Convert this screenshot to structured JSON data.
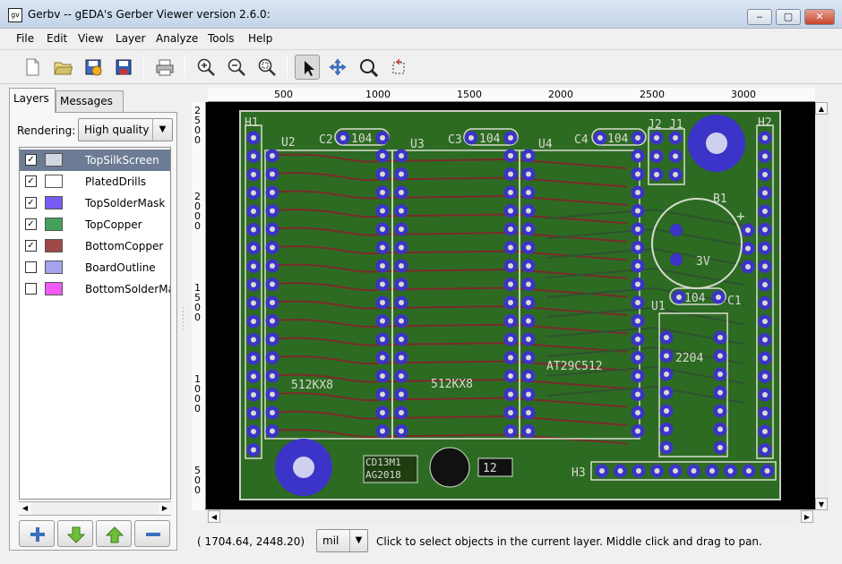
{
  "window": {
    "title": "Gerbv -- gEDA's Gerber Viewer version 2.6.0:",
    "app_icon_text": "gv",
    "controls": {
      "minimize": "‒",
      "maximize": "▢",
      "close": "✕"
    }
  },
  "menu": [
    "File",
    "Edit",
    "View",
    "Layer",
    "Analyze",
    "Tools",
    "Help"
  ],
  "toolbar_icons": [
    "new-file-icon",
    "open-folder-icon",
    "revert-icon",
    "save-icon",
    "print-icon",
    "zoom-in-icon",
    "zoom-out-icon",
    "zoom-fit-icon",
    "pointer-tool-icon",
    "pan-tool-icon",
    "zoom-tool-icon",
    "measure-tool-icon"
  ],
  "tabs": [
    "Layers",
    "Messages"
  ],
  "rendering": {
    "label": "Rendering:",
    "value": "High quality",
    "arrow": "▼"
  },
  "layers": [
    {
      "name": "TopSilkScreen",
      "checked": true,
      "color": "#d3d7e1"
    },
    {
      "name": "PlatedDrills",
      "checked": true,
      "color": "#ffffff"
    },
    {
      "name": "TopSolderMask",
      "checked": true,
      "color": "#7a5cf5"
    },
    {
      "name": "TopCopper",
      "checked": true,
      "color": "#44a05a"
    },
    {
      "name": "BottomCopper",
      "checked": true,
      "color": "#a04848"
    },
    {
      "name": "BoardOutline",
      "checked": false,
      "color": "#a3a3ee"
    },
    {
      "name": "BottomSolderMask",
      "checked": false,
      "color": "#f25af5"
    }
  ],
  "check_mark": "✓",
  "layer_buttons": [
    "add-layer-icon",
    "move-down-icon",
    "move-up-icon",
    "remove-layer-icon"
  ],
  "ruler_top": [
    "500",
    "1000",
    "1500",
    "2000",
    "2500",
    "3000"
  ],
  "ruler_left": [
    "2\n5\n0\n0",
    "2\n0\n0\n0",
    "1\n5\n0\n0",
    "1\n0\n0\n0",
    "5\n0\n0"
  ],
  "pcb_labels": {
    "h1": "H1",
    "h2": "H2",
    "h3": "H3",
    "u1": "U1",
    "u2": "U2",
    "u3": "U3",
    "u4": "U4",
    "c1": "C1",
    "c2": "C2",
    "c3": "C3",
    "c4": "C4",
    "j1": "J1",
    "j2": "J2",
    "b1": "B1",
    "cap_value": "104",
    "battery": "3V",
    "plus": "+",
    "chip1": "512KX8",
    "chip2": "512KX8",
    "flash": "AT29C512",
    "u1_part": "2204",
    "logo1": "CD13M1",
    "logo2": "AG2018",
    "badge": "12"
  },
  "status": {
    "coords": "( 1704.64,  2448.20)",
    "unit": "mil",
    "unit_arrow": "▼",
    "message": "Click to select objects in the current layer. Middle click and drag to pan."
  },
  "colors": {
    "board": "#2d6b23",
    "silk": "#d8dcd0",
    "pad": "#3c33c8",
    "copper_bottom": "#7b2a2a"
  }
}
